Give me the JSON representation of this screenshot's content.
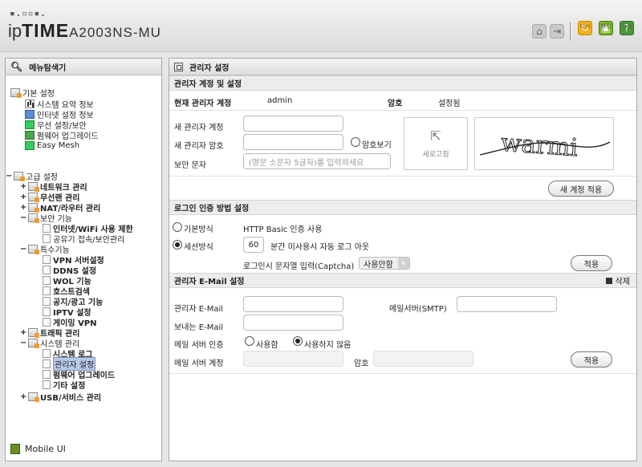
{
  "header": {
    "dots": "▪.▫▫▪.",
    "brand_ip": "ip",
    "brand_time": "TIME",
    "model": "A2003NS-MU",
    "buttons": [
      {
        "label": "다시"
      },
      {
        "label": "저장"
      },
      {
        "label": "도움"
      }
    ]
  },
  "sidebar": {
    "title": "메뉴탐색기",
    "basic_group": "기본 설정",
    "basic_items": [
      "시스템 요약 정보",
      "인터넷 설정 정보",
      "무선 설정/보안",
      "펌웨어 업그레이드",
      "Easy Mesh"
    ],
    "adv_group": "고급 설정",
    "adv": {
      "network": "네트워크 관리",
      "wireless": "무선랜 관리",
      "nat": "NAT/라우터 관리",
      "security": "보안 기능",
      "sec_items": [
        "인터넷/WiFi 사용 제한",
        "공유기 접속/보안관리"
      ],
      "special": "특수기능",
      "special_items": [
        "VPN 서버설정",
        "DDNS 설정",
        "WOL 기능",
        "호스트검색",
        "공지/광고 기능",
        "IPTV 설정",
        "게이밍 VPN"
      ],
      "traffic": "트래픽 관리",
      "system": "시스템 관리",
      "system_items": [
        "시스템 로그",
        "관리자 설정",
        "펌웨어 업그레이드",
        "기타 설정"
      ],
      "usb": "USB/서비스 관리"
    },
    "mobile": "Mobile UI"
  },
  "main": {
    "title": "관리자 설정",
    "account_section": "관리자 계정 및 설정",
    "current_label": "현재 관리자 계정",
    "current_value": "admin",
    "pw_label": "암호",
    "pw_value": "설정됨",
    "new_account_label": "새 관리자 계정",
    "new_pw_label": "새 관리자 암호",
    "show_pw_label": "암호보기",
    "captcha_label": "보안 문자",
    "captcha_placeholder": "(영문 소문자 5글자)를 입력하세요",
    "refresh_label": "새로고침",
    "captcha_text": "warmi",
    "apply_account": "새 계정 적용",
    "login_section": "로그인 인증 방법 설정",
    "basic_auth": "기본방식",
    "basic_auth_desc": "HTTP Basic 인증 사용",
    "session_auth": "세션방식",
    "session_minutes": "60",
    "session_desc": "분간 미사용시 자동 로그 아웃",
    "captcha_login_label": "로그인시 문자열 입력(Captcha)",
    "captcha_login_value": "사용안함",
    "apply": "적용",
    "email_section": "관리자 E-Mail 설정",
    "delete": "삭제",
    "admin_email": "관리자 E-Mail",
    "smtp": "메일서버(SMTP)",
    "sender_email": "보내는 E-Mail",
    "auth_label": "메일 서버 인증",
    "auth_use": "사용함",
    "auth_nouse": "사용하지 않음",
    "server_account": "메일 서버 계정",
    "server_pw": "암호"
  },
  "colors": {
    "selected": "#b8c8e8",
    "section_bg": "#ececec"
  }
}
